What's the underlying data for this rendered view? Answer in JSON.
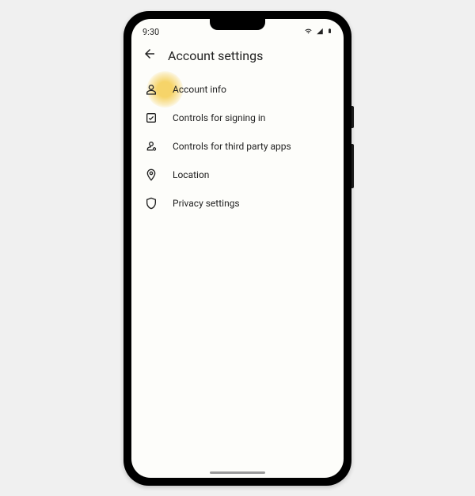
{
  "statusbar": {
    "time": "9:30"
  },
  "header": {
    "title": "Account settings"
  },
  "highlight_index": 0,
  "menu": {
    "items": [
      {
        "icon": "person-icon",
        "label": "Account info"
      },
      {
        "icon": "signin-icon",
        "label": "Controls for signing in"
      },
      {
        "icon": "thirdparty-icon",
        "label": "Controls for third party apps"
      },
      {
        "icon": "location-icon",
        "label": "Location"
      },
      {
        "icon": "privacy-icon",
        "label": "Privacy settings"
      }
    ]
  }
}
